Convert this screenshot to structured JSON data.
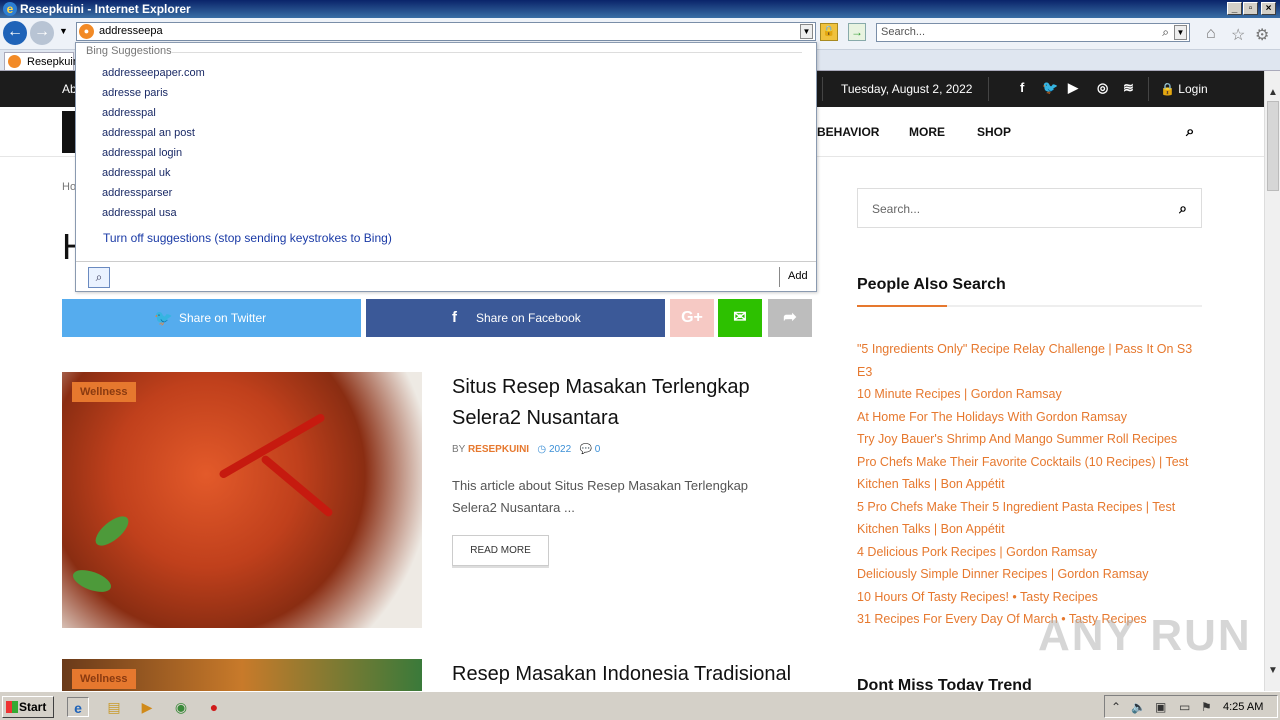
{
  "window": {
    "title": "Resepkuini - Internet Explorer"
  },
  "addressbar": {
    "value": "addresseepa",
    "search_placeholder": "Search..."
  },
  "tab": {
    "label": "Resepkuini"
  },
  "suggestions": {
    "header": "Bing Suggestions",
    "items": [
      "addresseepaper.com",
      "adresse paris",
      "addresspal",
      "addresspal an post",
      "addresspal login",
      "addresspal uk",
      "addressparser",
      "addresspal usa"
    ],
    "turn_off": "Turn off suggestions (stop sending keystrokes to Bing)",
    "add_label": "Add"
  },
  "site": {
    "topbar": {
      "about": "Ab",
      "date": "Tuesday, August 2, 2022",
      "login": "Login"
    },
    "nav": [
      "BEHAVIOR",
      "MORE",
      "SHOP"
    ],
    "breadcrumb": "Ho",
    "page_title": "H",
    "share": {
      "twitter": "Share on Twitter",
      "facebook": "Share on Facebook"
    },
    "posts": [
      {
        "category": "Wellness",
        "title": "Situs Resep Masakan Terlengkap Selera2 Nusantara",
        "by": "BY",
        "author": "RESEPKUINI",
        "year": "2022",
        "comments": "0",
        "excerpt": "This article about Situs Resep Masakan Terlengkap Selera2 Nusantara ...",
        "read_more": "READ MORE"
      },
      {
        "category": "Wellness",
        "title": "Resep Masakan Indonesia Tradisional"
      }
    ],
    "sidebar": {
      "search_placeholder": "Search...",
      "people_also_search": "People Also Search",
      "links": [
        "\"5 Ingredients Only\" Recipe Relay Challenge | Pass It On S3 E3",
        "10 Minute Recipes | Gordon Ramsay",
        "At Home For The Holidays With Gordon Ramsay",
        "Try Joy Bauer's Shrimp And Mango Summer Roll Recipes",
        "Pro Chefs Make Their Favorite Cocktails (10 Recipes) | Test Kitchen Talks | Bon Appétit",
        "5 Pro Chefs Make Their 5 Ingredient Pasta Recipes | Test Kitchen Talks | Bon Appétit",
        "4 Delicious Pork Recipes | Gordon Ramsay",
        "Deliciously Simple Dinner Recipes | Gordon Ramsay",
        "10 Hours Of Tasty Recipes! • Tasty Recipes",
        "31 Recipes For Every Day Of March • Tasty Recipes"
      ],
      "dont_miss": "Dont Miss Today Trend"
    }
  },
  "watermark": "ANY RUN",
  "taskbar": {
    "start": "Start",
    "clock": "4:25 AM"
  },
  "colors": {
    "accent": "#e6782e",
    "twitter": "#55acee",
    "facebook": "#3b5998",
    "wechat": "#2dc100"
  }
}
